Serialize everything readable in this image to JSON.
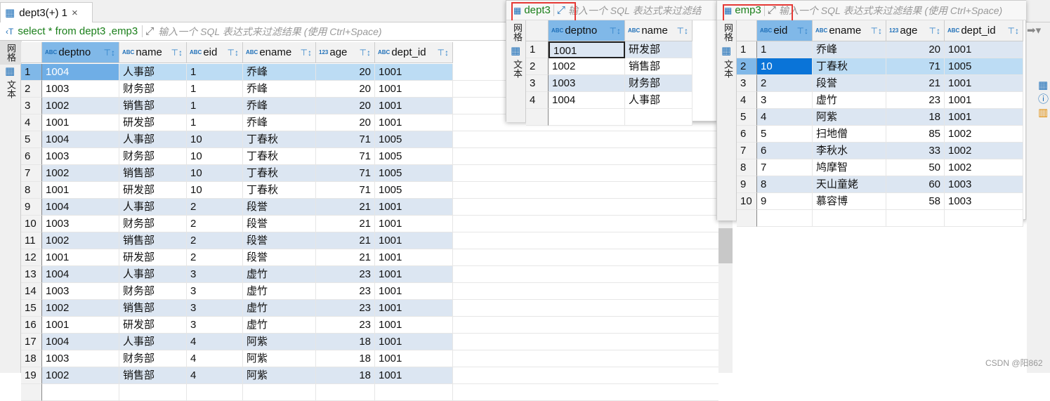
{
  "tab": {
    "title": "dept3(+) 1",
    "close": "×"
  },
  "filter": {
    "sql": "select * from dept3 ,emp3",
    "placeholder": "输入一个 SQL 表达式来过滤结果 (使用 Ctrl+Space)"
  },
  "side_tabs": {
    "grid": "网格",
    "text": "文本"
  },
  "main": {
    "columns": [
      "deptno",
      "name",
      "eid",
      "ename",
      "age",
      "dept_id"
    ],
    "types": [
      "ABC",
      "ABC",
      "ABC",
      "ABC",
      "123",
      "ABC"
    ],
    "rows": [
      [
        "1004",
        "人事部",
        "1",
        "乔峰",
        "20",
        "1001"
      ],
      [
        "1003",
        "财务部",
        "1",
        "乔峰",
        "20",
        "1001"
      ],
      [
        "1002",
        "销售部",
        "1",
        "乔峰",
        "20",
        "1001"
      ],
      [
        "1001",
        "研发部",
        "1",
        "乔峰",
        "20",
        "1001"
      ],
      [
        "1004",
        "人事部",
        "10",
        "丁春秋",
        "71",
        "1005"
      ],
      [
        "1003",
        "财务部",
        "10",
        "丁春秋",
        "71",
        "1005"
      ],
      [
        "1002",
        "销售部",
        "10",
        "丁春秋",
        "71",
        "1005"
      ],
      [
        "1001",
        "研发部",
        "10",
        "丁春秋",
        "71",
        "1005"
      ],
      [
        "1004",
        "人事部",
        "2",
        "段誉",
        "21",
        "1001"
      ],
      [
        "1003",
        "财务部",
        "2",
        "段誉",
        "21",
        "1001"
      ],
      [
        "1002",
        "销售部",
        "2",
        "段誉",
        "21",
        "1001"
      ],
      [
        "1001",
        "研发部",
        "2",
        "段誉",
        "21",
        "1001"
      ],
      [
        "1004",
        "人事部",
        "3",
        "虚竹",
        "23",
        "1001"
      ],
      [
        "1003",
        "财务部",
        "3",
        "虚竹",
        "23",
        "1001"
      ],
      [
        "1002",
        "销售部",
        "3",
        "虚竹",
        "23",
        "1001"
      ],
      [
        "1001",
        "研发部",
        "3",
        "虚竹",
        "23",
        "1001"
      ],
      [
        "1004",
        "人事部",
        "4",
        "阿紫",
        "18",
        "1001"
      ],
      [
        "1003",
        "财务部",
        "4",
        "阿紫",
        "18",
        "1001"
      ],
      [
        "1002",
        "销售部",
        "4",
        "阿紫",
        "18",
        "1001"
      ]
    ]
  },
  "dept3": {
    "title": "dept3",
    "placeholder": "输入一个 SQL 表达式来过滤结果",
    "columns": [
      "deptno",
      "name"
    ],
    "types": [
      "ABC",
      "ABC"
    ],
    "rows": [
      [
        "1001",
        "研发部"
      ],
      [
        "1002",
        "销售部"
      ],
      [
        "1003",
        "财务部"
      ],
      [
        "1004",
        "人事部"
      ]
    ]
  },
  "emp3": {
    "title": "emp3",
    "placeholder": "输入一个 SQL 表达式来过滤结果 (使用 Ctrl+Space)",
    "columns": [
      "eid",
      "ename",
      "age",
      "dept_id"
    ],
    "types": [
      "ABC",
      "ABC",
      "123",
      "ABC"
    ],
    "rows": [
      [
        "1",
        "乔峰",
        "20",
        "1001"
      ],
      [
        "10",
        "丁春秋",
        "71",
        "1005"
      ],
      [
        "2",
        "段誉",
        "21",
        "1001"
      ],
      [
        "3",
        "虚竹",
        "23",
        "1001"
      ],
      [
        "4",
        "阿紫",
        "18",
        "1001"
      ],
      [
        "5",
        "扫地僧",
        "85",
        "1002"
      ],
      [
        "6",
        "李秋水",
        "33",
        "1002"
      ],
      [
        "7",
        "鸠摩智",
        "50",
        "1002"
      ],
      [
        "8",
        "天山童姥",
        "60",
        "1003"
      ],
      [
        "9",
        "慕容博",
        "58",
        "1003"
      ]
    ]
  },
  "watermark": "CSDN @阳862"
}
